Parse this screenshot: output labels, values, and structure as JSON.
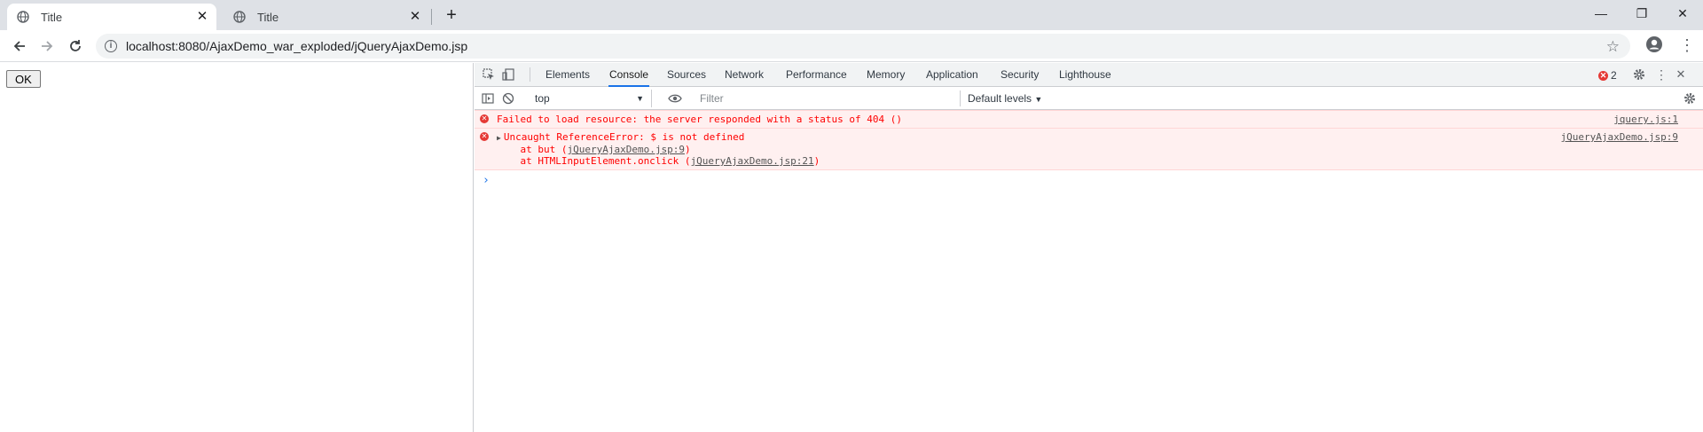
{
  "browser": {
    "tabs": [
      {
        "title": "Title",
        "active": true
      },
      {
        "title": "Title",
        "active": false
      }
    ],
    "new_tab": "+",
    "url": "localhost:8080/AjaxDemo_war_exploded/jQueryAjaxDemo.jsp",
    "window_controls": {
      "minimize": "—",
      "restore": "❐",
      "close": "✕"
    }
  },
  "page": {
    "ok_button": "OK"
  },
  "devtools": {
    "tabs": [
      "Elements",
      "Console",
      "Sources",
      "Network",
      "Performance",
      "Memory",
      "Application",
      "Security",
      "Lighthouse"
    ],
    "selected_tab": "Console",
    "error_count": "2",
    "context": "top",
    "filter_placeholder": "Filter",
    "levels": "Default levels",
    "messages": [
      {
        "text": "Failed to load resource: the server responded with a status of 404 ()",
        "source": "jquery.js:1"
      },
      {
        "text": "Uncaught ReferenceError: $ is not defined",
        "source": "jQueryAjaxDemo.jsp:9",
        "stack": [
          {
            "prefix": "    at but (",
            "link": "jQueryAjaxDemo.jsp:9",
            "suffix": ")"
          },
          {
            "prefix": "    at HTMLInputElement.onclick (",
            "link": "jQueryAjaxDemo.jsp:21",
            "suffix": ")"
          }
        ]
      }
    ],
    "prompt": "›"
  },
  "colors": {
    "accent": "#1a73e8",
    "error": "#ff0000",
    "error_bg": "#fff0f0"
  }
}
